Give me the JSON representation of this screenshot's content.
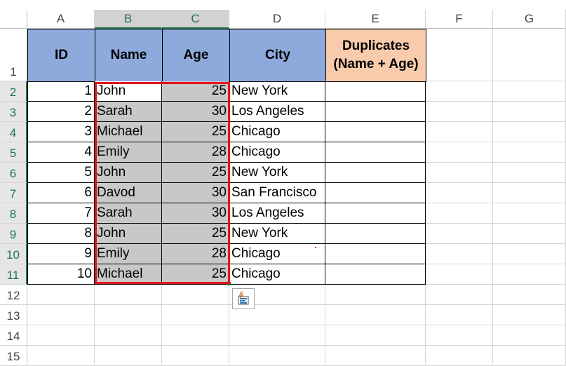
{
  "columns": [
    "A",
    "B",
    "C",
    "D",
    "E",
    "F",
    "G"
  ],
  "selected_columns": [
    "B",
    "C"
  ],
  "rows": [
    "1",
    "2",
    "3",
    "4",
    "5",
    "6",
    "7",
    "8",
    "9",
    "10",
    "11",
    "12",
    "13",
    "14",
    "15"
  ],
  "selected_rows": [
    "2",
    "3",
    "4",
    "5",
    "6",
    "7",
    "8",
    "9",
    "10",
    "11"
  ],
  "table": {
    "headers": {
      "id": "ID",
      "name": "Name",
      "age": "Age",
      "city": "City",
      "duplicates_line1": "Duplicates",
      "duplicates_line2": "(Name + Age)"
    },
    "records": [
      {
        "id": "1",
        "name": "John",
        "age": "25",
        "city": "New York",
        "duplicates": ""
      },
      {
        "id": "2",
        "name": "Sarah",
        "age": "30",
        "city": "Los Angeles",
        "duplicates": ""
      },
      {
        "id": "3",
        "name": "Michael",
        "age": "25",
        "city": "Chicago",
        "duplicates": ""
      },
      {
        "id": "4",
        "name": "Emily",
        "age": "28",
        "city": "Chicago",
        "duplicates": ""
      },
      {
        "id": "5",
        "name": "John",
        "age": "25",
        "city": "New York",
        "duplicates": ""
      },
      {
        "id": "6",
        "name": "Davod",
        "age": "30",
        "city": "San Francisco",
        "duplicates": ""
      },
      {
        "id": "7",
        "name": "Sarah",
        "age": "30",
        "city": "Los Angeles",
        "duplicates": ""
      },
      {
        "id": "8",
        "name": "John",
        "age": "25",
        "city": "New York",
        "duplicates": ""
      },
      {
        "id": "9",
        "name": "Emily",
        "age": "28",
        "city": "Chicago",
        "duplicates": ""
      },
      {
        "id": "10",
        "name": "Michael",
        "age": "25",
        "city": "Chicago",
        "duplicates": ""
      }
    ]
  },
  "colors": {
    "header_fill": "#8ea9db",
    "duplicates_header_fill": "#f8cbad",
    "selection_fill": "#c8c8c8",
    "selection_outline": "#e3141b",
    "excel_green": "#217346"
  },
  "quick_analysis_icon": "quick-analysis-icon"
}
